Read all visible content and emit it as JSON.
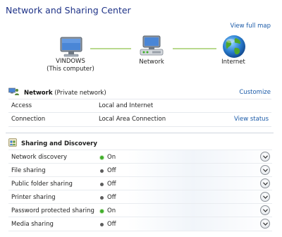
{
  "window": {
    "title": "Network and Sharing Center"
  },
  "map": {
    "view_full_map": "View full map",
    "computer_name": "VINDOWS",
    "computer_sub": "(This computer)",
    "network_label": "Network",
    "internet_label": "Internet"
  },
  "network": {
    "name": "Network",
    "type": "(Private network)",
    "customize": "Customize",
    "rows": [
      {
        "key": "Access",
        "value": "Local and Internet",
        "action": ""
      },
      {
        "key": "Connection",
        "value": "Local Area Connection",
        "action": "View status"
      }
    ]
  },
  "sharing": {
    "title": "Sharing and Discovery",
    "rows": [
      {
        "key": "Network discovery",
        "state": "On",
        "on": true
      },
      {
        "key": "File sharing",
        "state": "Off",
        "on": false
      },
      {
        "key": "Public folder sharing",
        "state": "Off",
        "on": false
      },
      {
        "key": "Printer sharing",
        "state": "Off",
        "on": false
      },
      {
        "key": "Password protected sharing",
        "state": "On",
        "on": true
      },
      {
        "key": "Media sharing",
        "state": "Off",
        "on": false
      }
    ]
  },
  "colors": {
    "accent": "#1a5aa8",
    "title": "#1e3287",
    "on": "#3fae2a",
    "connector": "#b9d98e"
  }
}
